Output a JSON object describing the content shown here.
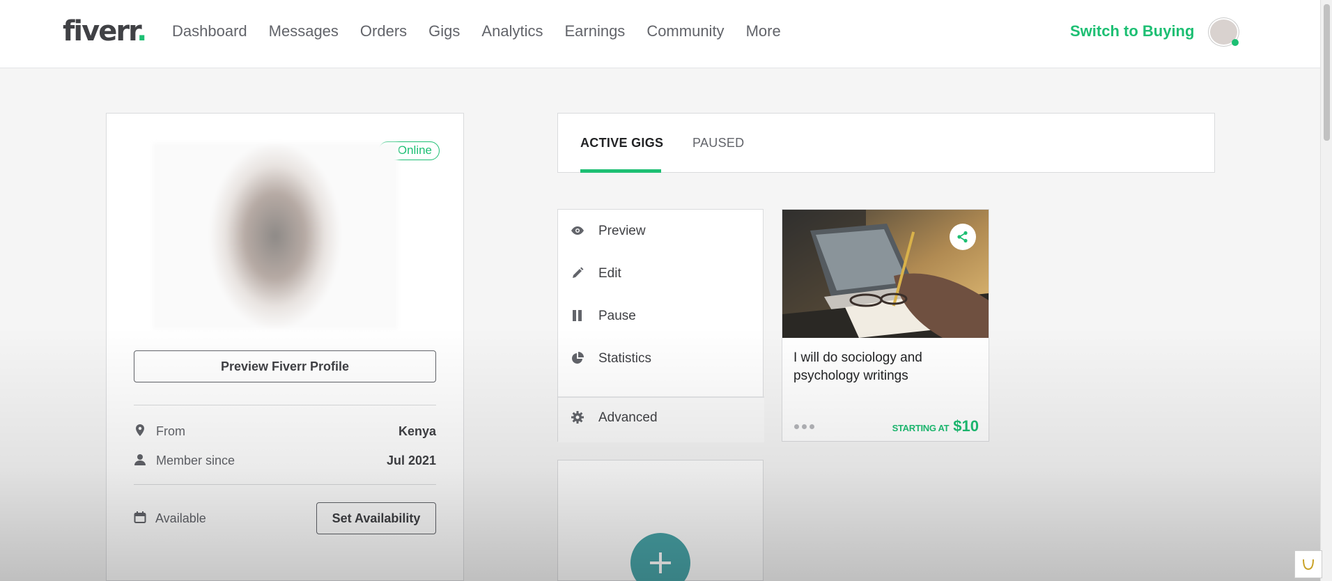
{
  "header": {
    "logo": "fiverr",
    "logo_dot": ".",
    "nav": [
      "Dashboard",
      "Messages",
      "Orders",
      "Gigs",
      "Analytics",
      "Earnings",
      "Community",
      "More"
    ],
    "switch_label": "Switch to Buying"
  },
  "profile": {
    "status_badge": "Online",
    "preview_button": "Preview Fiverr Profile",
    "from_label": "From",
    "from_value": "Kenya",
    "member_label": "Member since",
    "member_value": "Jul 2021",
    "available_label": "Available",
    "set_availability_button": "Set Availability"
  },
  "tabs": {
    "active": "ACTIVE GIGS",
    "paused": "PAUSED"
  },
  "gig_menu": {
    "items": [
      "Preview",
      "Edit",
      "Pause",
      "Statistics",
      "Advanced"
    ]
  },
  "gig": {
    "title": "I will do sociology and psychology writings",
    "starting_label": "STARTING AT",
    "price": "$10"
  },
  "colors": {
    "brand_green": "#1dbf73",
    "create_button": "#49a5a9",
    "text_dark": "#404145"
  }
}
